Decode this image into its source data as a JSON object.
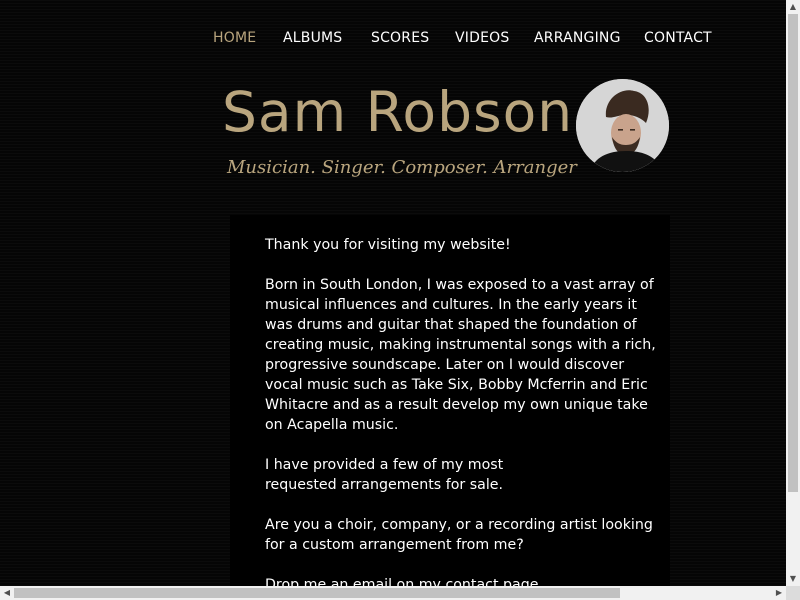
{
  "nav": {
    "items": [
      {
        "label": "HOME",
        "active": true
      },
      {
        "label": "ALBUMS",
        "active": false
      },
      {
        "label": "SCORES",
        "active": false
      },
      {
        "label": "VIDEOS",
        "active": false
      },
      {
        "label": "ARRANGING",
        "active": false
      },
      {
        "label": "CONTACT",
        "active": false
      }
    ]
  },
  "header": {
    "title": "Sam Robson",
    "subtitle": "Musician. Singer. Composer. Arranger"
  },
  "content": {
    "paragraphs": [
      "Thank you for visiting my website!",
      "Born in South London, I was exposed to a vast array of musical influences and cultures. In the early years it was drums and guitar that shaped the foundation of creating music, making instrumental songs with a rich, progressive soundscape. Later on I would discover vocal music such as Take Six, Bobby Mcferrin and Eric Whitacre and as a result develop my own unique take on Acapella music.",
      "I have provided a few of my most requested arrangements for sale.",
      "Are you a choir, company, or a recording artist looking for a custom arrangement from me?",
      "Drop me an email on my contact page"
    ]
  },
  "colors": {
    "accent": "#b9a57e",
    "background": "#000000",
    "text": "#ffffff"
  }
}
